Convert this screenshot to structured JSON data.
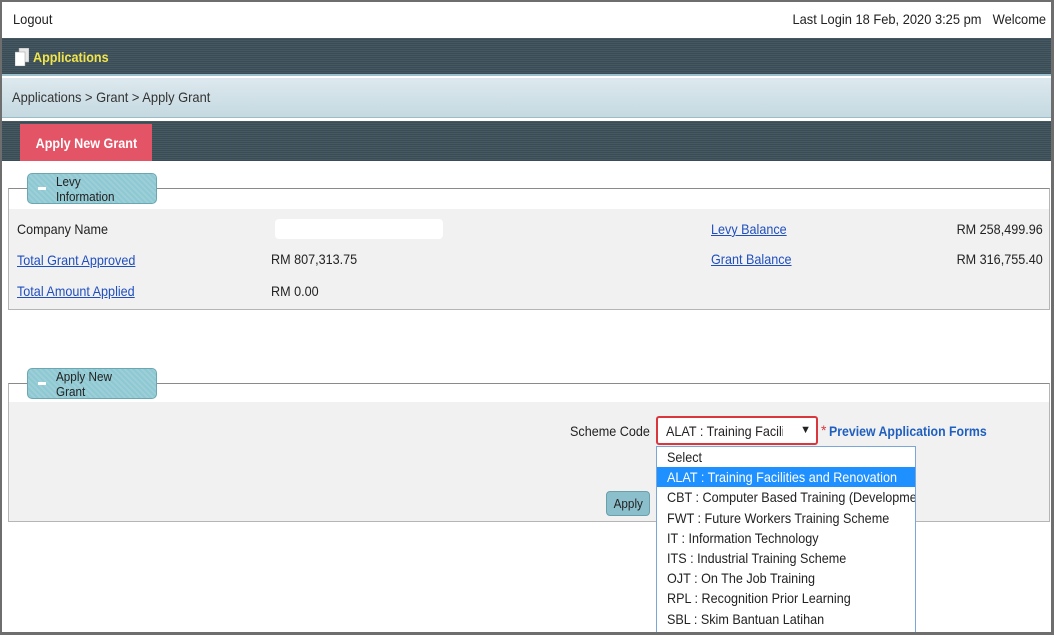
{
  "header": {
    "logout_label": "Logout",
    "last_login": "Last Login 18 Feb, 2020 3:25 pm",
    "welcome": "Welcome"
  },
  "app_bar": {
    "title": "Applications",
    "icon": "document-icon"
  },
  "breadcrumb": "Applications > Grant > Apply Grant",
  "tabs": [
    {
      "label": "Apply New Grant",
      "active": true
    }
  ],
  "levy_info": {
    "legend": "Levy Information",
    "company_name_label": "Company Name",
    "company_name_value": "",
    "total_grant_approved_label": "Total Grant Approved",
    "total_grant_approved_value": "RM 807,313.75",
    "total_amount_applied_label": "Total Amount Applied",
    "total_amount_applied_value": "RM 0.00",
    "levy_balance_label": "Levy Balance",
    "levy_balance_value": "RM 258,499.96",
    "grant_balance_label": "Grant Balance",
    "grant_balance_value": "RM 316,755.40"
  },
  "apply_grant": {
    "legend": "Apply New Grant",
    "scheme_code_label": "Scheme Code",
    "selected_value": "ALAT : Training Facilities",
    "required_mark": "*",
    "preview_link": "Preview Application Forms",
    "apply_button": "Apply"
  },
  "dropdown": {
    "options": [
      "Select",
      "ALAT : Training Facilities and Renovation",
      "CBT : Computer Based Training (Development)",
      "FWT : Future Workers Training Scheme",
      "IT : Information Technology",
      "ITS : Industrial Training Scheme",
      "OJT : On The Job Training",
      "RPL : Recognition Prior Learning",
      "SBL : Skim Bantuan Latihan"
    ],
    "highlighted_index": 1
  },
  "colors": {
    "app_bar_bg": "#3a4c57",
    "app_title": "#f2e54b",
    "tab_active": "#e35566",
    "legend_bg": "#8ec8d2",
    "link": "#1f4fbf",
    "dropdown_highlight": "#1e90ff"
  }
}
